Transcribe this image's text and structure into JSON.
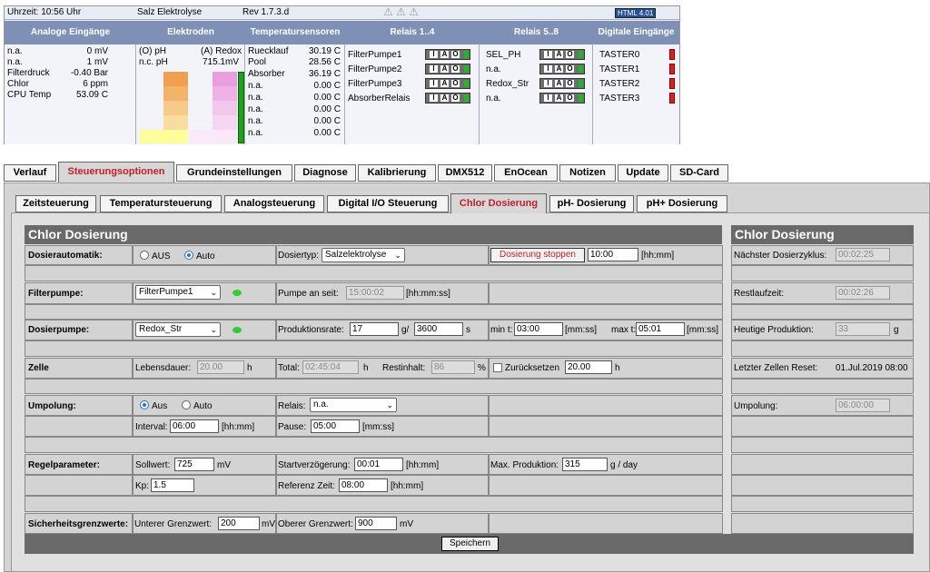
{
  "status": {
    "time": "Uhrzeit: 10:56 Uhr",
    "product": "Salz Elektrolyse",
    "rev": "Rev 1.7.3.d",
    "badge": "HTML 4.01",
    "headers": {
      "analog": "Analoge Eingänge",
      "elektroden": "Elektroden",
      "temp": "Temperatursensoren",
      "relais14": "Relais 1..4",
      "relais58": "Relais 5..8",
      "digital": "Digitale Eingänge"
    },
    "analog": [
      {
        "name": "n.a.",
        "value": "0 mV"
      },
      {
        "name": "n.a.",
        "value": "1 mV"
      },
      {
        "name": "Filterdruck",
        "value": "-0.40 Bar"
      },
      {
        "name": "Chlor",
        "value": "6 ppm"
      },
      {
        "name": "CPU Temp",
        "value": "53.09 C"
      }
    ],
    "elektroden": {
      "ph_label": "(O) pH",
      "redox_label": "(A) Redox",
      "ph_sub": "n.c. pH",
      "redox_value": "715.1mV"
    },
    "temps": [
      {
        "name": "Ruecklauf",
        "value": "30.19 C"
      },
      {
        "name": "Pool",
        "value": "28.56 C"
      },
      {
        "name": "Absorber",
        "value": "36.19 C"
      },
      {
        "name": "n.a.",
        "value": "0.00 C"
      },
      {
        "name": "n.a.",
        "value": "0.00 C"
      },
      {
        "name": "n.a.",
        "value": "0.00 C"
      },
      {
        "name": "n.a.",
        "value": "0.00 C"
      },
      {
        "name": "n.a.",
        "value": "0.00 C"
      }
    ],
    "relais14": [
      "FilterPumpe1",
      "FilterPumpe2",
      "FilterPumpe3",
      "AbsorberRelais"
    ],
    "relais58": [
      "SEL_PH",
      "n.a.",
      "Redox_Str",
      "n.a."
    ],
    "digital": [
      "TASTER0",
      "TASTER1",
      "TASTER2",
      "TASTER3"
    ],
    "iao": {
      "i": "I",
      "a": "A",
      "o": "O"
    }
  },
  "nav": {
    "tabs": [
      "Verlauf",
      "Steuerungsoptionen",
      "Grundeinstellungen",
      "Diagnose",
      "Kalibrierung",
      "DMX512",
      "EnOcean",
      "Notizen",
      "Update",
      "SD-Card"
    ],
    "subtabs": [
      "Zeitsteuerung",
      "Temperatursteuerung",
      "Analogsteuerung",
      "Digital I/O Steuerung",
      "Chlor Dosierung",
      "pH- Dosierung",
      "pH+ Dosierung"
    ]
  },
  "form": {
    "title": "Chlor Dosierung",
    "side_title": "Chlor Dosierung",
    "dosierautomatik": {
      "label": "Dosierautomatik:",
      "aus": "AUS",
      "auto": "Auto",
      "dosiertyp_label": "Dosiertyp:",
      "dosiertyp": "Salzelektrolyse",
      "stop_button": "Dosierung stoppen",
      "time": "10:00",
      "unit": "[hh:mm]"
    },
    "filterpumpe": {
      "label": "Filterpumpe:",
      "select": "FilterPumpe1",
      "an_seit_label": "Pumpe an seit:",
      "an_seit": "15:00:02",
      "unit": "[hh:mm:ss]"
    },
    "dosierpumpe": {
      "label": "Dosierpumpe:",
      "select": "Redox_Str",
      "prod_label": "Produktionsrate:",
      "prod_g": "17",
      "g_unit": "g/",
      "prod_s": "3600",
      "s_unit": "s",
      "min_label": "min t:",
      "min_t": "03:00",
      "min_unit": "[mm:ss]",
      "max_label": "max t:",
      "max_t": "05:01",
      "max_unit": "[mm:ss]"
    },
    "zelle": {
      "label": "Zelle",
      "lebensdauer_label": "Lebensdauer:",
      "lebensdauer": "20.00",
      "h1": "h",
      "total_label": "Total:",
      "total": "02:45:04",
      "h2": "h",
      "restinhalt_label": "Restinhalt:",
      "restinhalt": "86",
      "pct": "%",
      "reset_label": "Zurücksetzen",
      "reset_value": "20.00",
      "h3": "h"
    },
    "umpolung": {
      "label": "Umpolung:",
      "aus": "Aus",
      "auto": "Auto",
      "relais_label": "Relais:",
      "relais": "n.a.",
      "interval_label": "Interval:",
      "interval": "06:00",
      "interval_unit": "[hh:mm]",
      "pause_label": "Pause:",
      "pause": "05:00",
      "pause_unit": "[mm:ss]"
    },
    "regel": {
      "label": "Regelparameter:",
      "sollwert_label": "Sollwert:",
      "sollwert": "725",
      "mv": "mV",
      "start_label": "Startverzögerung:",
      "start": "00:01",
      "start_unit": "[hh:mm]",
      "maxprod_label": "Max. Produktion:",
      "maxprod": "315",
      "maxprod_unit": "g / day",
      "kp_label": "Kp:",
      "kp": "1.5",
      "ref_label": "Referenz Zeit:",
      "ref": "08:00",
      "ref_unit": "[hh:mm]"
    },
    "sicherheit": {
      "label": "Sicherheitsgrenzwerte:",
      "unter_label": "Unterer Grenzwert:",
      "unter": "200",
      "mv1": "mV",
      "ober_label": "Oberer Grenzwert:",
      "ober": "900",
      "mv2": "mV"
    },
    "save": "Speichern",
    "side": {
      "next_label": "Nächster Dosierzyklus:",
      "next": "00:02:25",
      "rest_label": "Restlaufzeit:",
      "rest": "00:02:26",
      "heute_label": "Heutige Produktion:",
      "heute": "33",
      "g": "g",
      "reset_label": "Letzter Zellen Reset:",
      "reset": "01.Jul.2019 08:00",
      "umpol_label": "Umpolung:",
      "umpol": "06:00:00"
    }
  }
}
